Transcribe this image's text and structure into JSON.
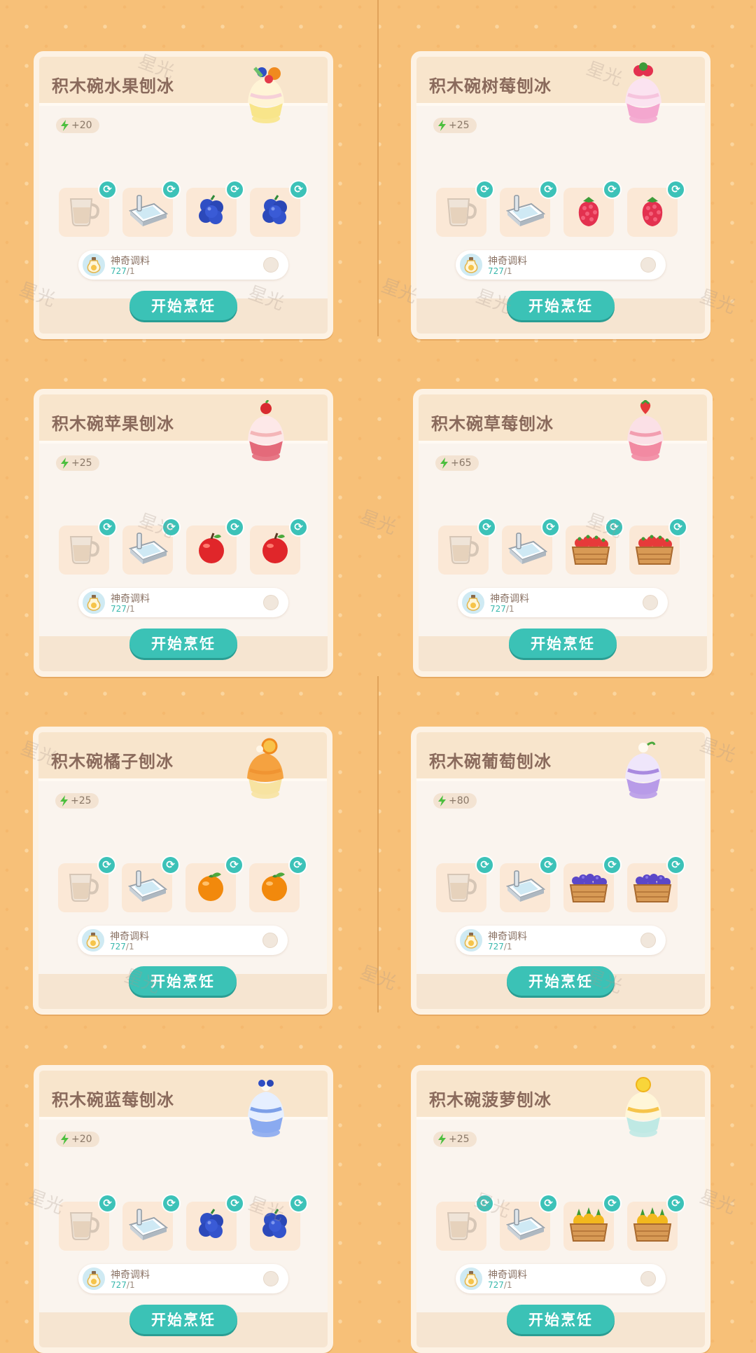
{
  "watermark_text": "星光",
  "cook_label": "开始烹饪",
  "colors": {
    "accent": "#3bc2b6",
    "background": "#f7c078",
    "card": "#faf4ee",
    "header": "#f8e5cc"
  },
  "recipes": [
    {
      "title": "积木碗水果刨冰",
      "energy": "+20",
      "dish_icon": "fruit-shaved-ice-icon",
      "ingredients": [
        "milk-cup-icon",
        "ice-tray-icon",
        "blueberry-icon",
        "blueberry-icon"
      ],
      "seasoning": {
        "name": "神奇调料",
        "have": "727",
        "need": "/1"
      }
    },
    {
      "title": "积木碗树莓刨冰",
      "energy": "+25",
      "dish_icon": "raspberry-shaved-ice-icon",
      "ingredients": [
        "milk-cup-icon",
        "ice-tray-icon",
        "raspberry-icon",
        "raspberry-icon"
      ],
      "seasoning": {
        "name": "神奇调料",
        "have": "727",
        "need": "/1"
      }
    },
    {
      "title": "积木碗苹果刨冰",
      "energy": "+25",
      "dish_icon": "apple-shaved-ice-icon",
      "ingredients": [
        "milk-cup-icon",
        "ice-tray-icon",
        "apple-icon",
        "apple-icon"
      ],
      "seasoning": {
        "name": "神奇调料",
        "have": "727",
        "need": "/1"
      }
    },
    {
      "title": "积木碗草莓刨冰",
      "energy": "+65",
      "dish_icon": "strawberry-shaved-ice-icon",
      "ingredients": [
        "milk-cup-icon",
        "ice-tray-icon",
        "strawberry-crate-icon",
        "strawberry-crate-icon"
      ],
      "seasoning": {
        "name": "神奇调料",
        "have": "727",
        "need": "/1"
      }
    },
    {
      "title": "积木碗橘子刨冰",
      "energy": "+25",
      "dish_icon": "orange-shaved-ice-icon",
      "ingredients": [
        "milk-cup-icon",
        "ice-tray-icon",
        "orange-icon",
        "orange-icon"
      ],
      "seasoning": {
        "name": "神奇调料",
        "have": "727",
        "need": "/1"
      }
    },
    {
      "title": "积木碗葡萄刨冰",
      "energy": "+80",
      "dish_icon": "grape-shaved-ice-icon",
      "ingredients": [
        "milk-cup-icon",
        "ice-tray-icon",
        "grape-crate-icon",
        "grape-crate-icon"
      ],
      "seasoning": {
        "name": "神奇调料",
        "have": "727",
        "need": "/1"
      }
    },
    {
      "title": "积木碗蓝莓刨冰",
      "energy": "+20",
      "dish_icon": "blueberry-shaved-ice-icon",
      "ingredients": [
        "milk-cup-icon",
        "ice-tray-icon",
        "blueberry-icon",
        "blueberry-icon"
      ],
      "seasoning": {
        "name": "神奇调料",
        "have": "727",
        "need": "/1"
      }
    },
    {
      "title": "积木碗菠萝刨冰",
      "energy": "+25",
      "dish_icon": "pineapple-shaved-ice-icon",
      "ingredients": [
        "milk-cup-icon",
        "ice-tray-icon",
        "pineapple-crate-icon",
        "pineapple-crate-icon"
      ],
      "seasoning": {
        "name": "神奇调料",
        "have": "727",
        "need": "/1"
      }
    }
  ]
}
